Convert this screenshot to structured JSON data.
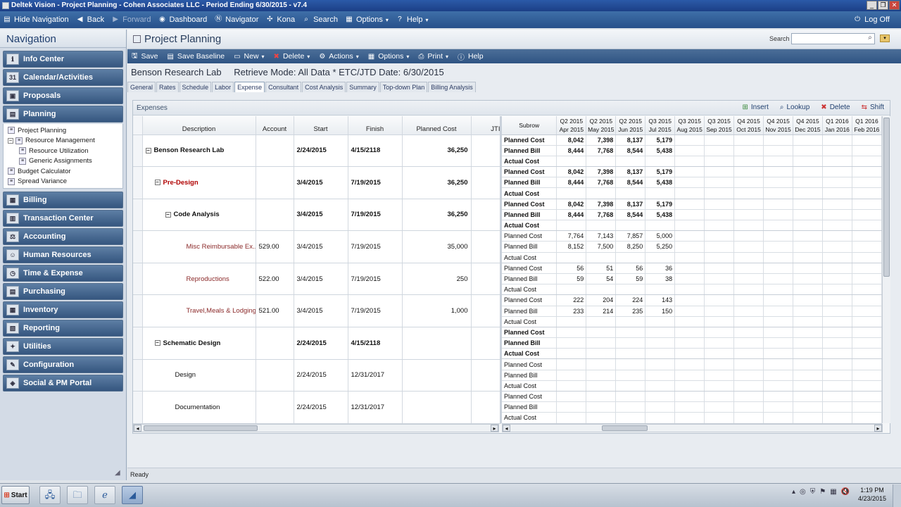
{
  "window": {
    "title": "Deltek Vision - Project Planning - Cohen Associates LLC - Period Ending 6/30/2015 - v7.4"
  },
  "topnav": {
    "hide_navigation": "Hide Navigation",
    "back": "Back",
    "forward": "Forward",
    "dashboard": "Dashboard",
    "navigator": "Navigator",
    "kona": "Kona",
    "search": "Search",
    "options": "Options",
    "help": "Help",
    "logoff": "Log Off"
  },
  "sidebar": {
    "title": "Navigation",
    "modules": [
      "Info Center",
      "Calendar/Activities",
      "Proposals",
      "Planning",
      "Billing",
      "Transaction Center",
      "Accounting",
      "Human Resources",
      "Time & Expense",
      "Purchasing",
      "Inventory",
      "Reporting",
      "Utilities",
      "Configuration",
      "Social & PM Portal"
    ],
    "planning_items": [
      "Project Planning",
      "Resource Management",
      "Resource Utilization",
      "Generic Assignments",
      "Budget Calculator",
      "Spread Variance"
    ]
  },
  "header": {
    "title": "Project Planning",
    "search_label": "Search",
    "search_value": ""
  },
  "toolbar": {
    "save": "Save",
    "save_baseline": "Save Baseline",
    "new": "New",
    "delete": "Delete",
    "actions": "Actions",
    "options": "Options",
    "print": "Print",
    "help": "Help"
  },
  "infobar": {
    "project": "Benson Research Lab",
    "retrieve": "Retrieve Mode: All Data * ETC/JTD Date: 6/30/2015"
  },
  "tabs": [
    "General",
    "Rates",
    "Schedule",
    "Labor",
    "Expense",
    "Consultant",
    "Cost Analysis",
    "Summary",
    "Top-down Plan",
    "Billing Analysis"
  ],
  "panel": {
    "title": "Expenses",
    "actions": {
      "insert": "Insert",
      "lookup": "Lookup",
      "delete": "Delete",
      "shift": "Shift"
    }
  },
  "left_grid": {
    "headers": {
      "description": "Description",
      "account": "Account",
      "start": "Start",
      "finish": "Finish",
      "planned_cost": "Planned Cost",
      "jtd": "JTI"
    },
    "rows": [
      {
        "description": "Benson Research Lab",
        "account": "",
        "start": "2/24/2015",
        "finish": "4/15/2118",
        "planned_cost": "36,250"
      },
      {
        "description": "Pre-Design",
        "account": "",
        "start": "3/4/2015",
        "finish": "7/19/2015",
        "planned_cost": "36,250"
      },
      {
        "description": "Code Analysis",
        "account": "",
        "start": "3/4/2015",
        "finish": "7/19/2015",
        "planned_cost": "36,250"
      },
      {
        "description": "Misc Reimbursable Ex...",
        "account": "529.00",
        "start": "3/4/2015",
        "finish": "7/19/2015",
        "planned_cost": "35,000"
      },
      {
        "description": "Reproductions",
        "account": "522.00",
        "start": "3/4/2015",
        "finish": "7/19/2015",
        "planned_cost": "250"
      },
      {
        "description": "Travel,Meals & Lodging",
        "account": "521.00",
        "start": "3/4/2015",
        "finish": "7/19/2015",
        "planned_cost": "1,000"
      },
      {
        "description": "Schematic Design",
        "account": "",
        "start": "2/24/2015",
        "finish": "4/15/2118",
        "planned_cost": ""
      },
      {
        "description": "Design",
        "account": "",
        "start": "2/24/2015",
        "finish": "12/31/2017",
        "planned_cost": ""
      },
      {
        "description": "Documentation",
        "account": "",
        "start": "2/24/2015",
        "finish": "12/31/2017",
        "planned_cost": ""
      }
    ]
  },
  "right_grid": {
    "subrow_header": "Subrow",
    "periods": [
      {
        "q": "Q2 2015",
        "m": "Apr 2015"
      },
      {
        "q": "Q2 2015",
        "m": "May 2015"
      },
      {
        "q": "Q2 2015",
        "m": "Jun 2015"
      },
      {
        "q": "Q3 2015",
        "m": "Jul 2015"
      },
      {
        "q": "Q3 2015",
        "m": "Aug 2015"
      },
      {
        "q": "Q3 2015",
        "m": "Sep 2015"
      },
      {
        "q": "Q4 2015",
        "m": "Oct 2015"
      },
      {
        "q": "Q4 2015",
        "m": "Nov 2015"
      },
      {
        "q": "Q4 2015",
        "m": "Dec 2015"
      },
      {
        "q": "Q1 2016",
        "m": "Jan 2016"
      },
      {
        "q": "Q1 2016",
        "m": "Feb 2016"
      }
    ],
    "rows": [
      {
        "label": "Planned Cost",
        "bold": true,
        "values": [
          "8,042",
          "7,398",
          "8,137",
          "5,179"
        ]
      },
      {
        "label": "Planned Bill",
        "bold": true,
        "values": [
          "8,444",
          "7,768",
          "8,544",
          "5,438"
        ]
      },
      {
        "label": "Actual Cost",
        "bold": true,
        "values": []
      },
      {
        "label": "Planned Cost",
        "bold": true,
        "values": [
          "8,042",
          "7,398",
          "8,137",
          "5,179"
        ]
      },
      {
        "label": "Planned Bill",
        "bold": true,
        "values": [
          "8,444",
          "7,768",
          "8,544",
          "5,438"
        ]
      },
      {
        "label": "Actual Cost",
        "bold": true,
        "values": []
      },
      {
        "label": "Planned Cost",
        "bold": true,
        "values": [
          "8,042",
          "7,398",
          "8,137",
          "5,179"
        ]
      },
      {
        "label": "Planned Bill",
        "bold": true,
        "values": [
          "8,444",
          "7,768",
          "8,544",
          "5,438"
        ]
      },
      {
        "label": "Actual Cost",
        "bold": true,
        "values": []
      },
      {
        "label": "Planned Cost",
        "bold": false,
        "values": [
          "7,764",
          "7,143",
          "7,857",
          "5,000"
        ]
      },
      {
        "label": "Planned Bill",
        "bold": false,
        "values": [
          "8,152",
          "7,500",
          "8,250",
          "5,250"
        ]
      },
      {
        "label": "Actual Cost",
        "bold": false,
        "values": []
      },
      {
        "label": "Planned Cost",
        "bold": false,
        "values": [
          "56",
          "51",
          "56",
          "36"
        ]
      },
      {
        "label": "Planned Bill",
        "bold": false,
        "values": [
          "59",
          "54",
          "59",
          "38"
        ]
      },
      {
        "label": "Actual Cost",
        "bold": false,
        "values": []
      },
      {
        "label": "Planned Cost",
        "bold": false,
        "values": [
          "222",
          "204",
          "224",
          "143"
        ]
      },
      {
        "label": "Planned Bill",
        "bold": false,
        "values": [
          "233",
          "214",
          "235",
          "150"
        ]
      },
      {
        "label": "Actual Cost",
        "bold": false,
        "values": []
      },
      {
        "label": "Planned Cost",
        "bold": true,
        "values": []
      },
      {
        "label": "Planned Bill",
        "bold": true,
        "values": []
      },
      {
        "label": "Actual Cost",
        "bold": true,
        "values": []
      },
      {
        "label": "Planned Cost",
        "bold": false,
        "values": []
      },
      {
        "label": "Planned Bill",
        "bold": false,
        "values": []
      },
      {
        "label": "Actual Cost",
        "bold": false,
        "values": []
      },
      {
        "label": "Planned Cost",
        "bold": false,
        "values": []
      },
      {
        "label": "Planned Bill",
        "bold": false,
        "values": []
      },
      {
        "label": "Actual Cost",
        "bold": false,
        "values": []
      }
    ]
  },
  "status": {
    "text": "Ready"
  },
  "taskbar": {
    "start": "Start",
    "time": "1:19 PM",
    "date": "4/23/2015"
  }
}
